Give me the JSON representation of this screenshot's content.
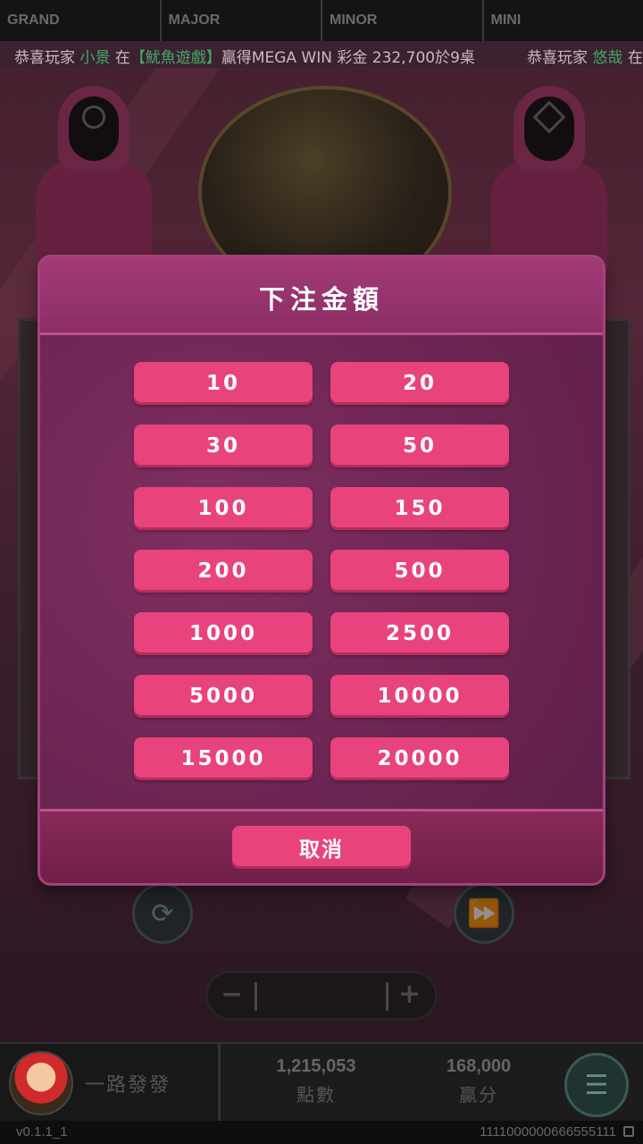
{
  "jackpots": [
    {
      "label": "GRAND"
    },
    {
      "label": "MAJOR"
    },
    {
      "label": "MINOR"
    },
    {
      "label": "MINI"
    }
  ],
  "ticker": {
    "prefix": "恭喜玩家",
    "player": "小景",
    "middle": "在",
    "game": "【魷魚遊戲】",
    "message": "贏得MEGA WIN 彩金 232,700於9桌",
    "prefix2": "恭喜玩家",
    "player2": "悠哉",
    "middle2": "在"
  },
  "modal": {
    "title": "下注金額",
    "bet_options": [
      "10",
      "20",
      "30",
      "50",
      "100",
      "150",
      "200",
      "500",
      "1000",
      "2500",
      "5000",
      "10000",
      "15000",
      "20000"
    ],
    "cancel_label": "取消"
  },
  "status": {
    "player_name": "一路發發",
    "points_value": "1,215,053",
    "points_label": "點數",
    "win_value": "168,000",
    "win_label": "贏分"
  },
  "footer": {
    "version": "v0.1.1_1",
    "session_id": "1111000000666555111"
  },
  "icons": {
    "refresh": "refresh-icon",
    "auto_play": "auto-play-icon",
    "menu": "menu-icon",
    "copy": "copy-icon"
  },
  "colors": {
    "accent_pink": "#e8437c",
    "modal_bg": "#7b2d5e",
    "ticker_highlight": "#46a866"
  }
}
